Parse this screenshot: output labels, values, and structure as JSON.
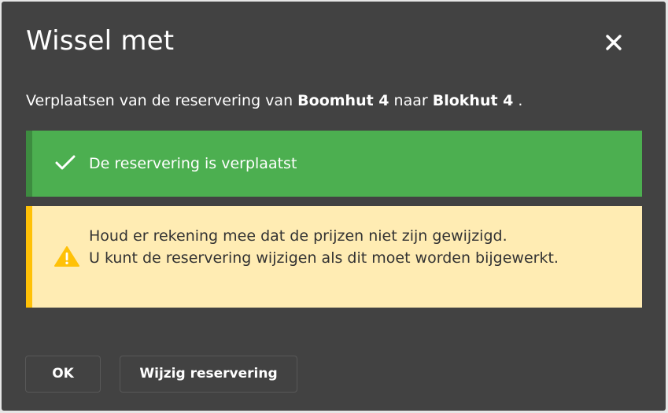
{
  "dialog": {
    "title": "Wissel met",
    "close_icon": "close-icon",
    "message": {
      "prefix": "Verplaatsen van de reservering van ",
      "from": "Boomhut 4",
      "middle": " naar ",
      "to": "Blokhut 4",
      "suffix": " ."
    },
    "success_alert": {
      "icon": "checkmark-icon",
      "text": "De reservering is verplaatst"
    },
    "warning_alert": {
      "icon": "warning-icon",
      "lines": [
        "Houd er rekening mee dat de prijzen niet zijn gewijzigd.",
        "U kunt de reservering wijzigen als dit moet worden bijgewerkt."
      ]
    },
    "buttons": {
      "ok": "OK",
      "edit": "Wijzig reservering"
    }
  },
  "colors": {
    "dialog_bg": "#424242",
    "success": "#4caf50",
    "warning_bg": "#ffecb3",
    "warning_accent": "#ffc107"
  }
}
